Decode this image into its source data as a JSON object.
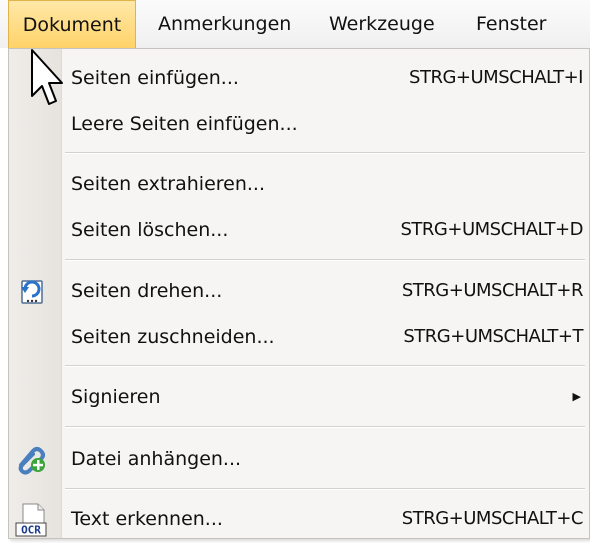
{
  "menubar": {
    "items": [
      {
        "label": "Dokument"
      },
      {
        "label": "Anmerkungen"
      },
      {
        "label": "Werkzeuge"
      },
      {
        "label": "Fenster"
      }
    ]
  },
  "dropdown": {
    "items": [
      {
        "label": "Seiten einfügen...",
        "shortcut": "STRG+UMSCHALT+I"
      },
      {
        "label": "Leere Seiten einfügen...",
        "shortcut": ""
      },
      {
        "label": "Seiten extrahieren...",
        "shortcut": ""
      },
      {
        "label": "Seiten löschen...",
        "shortcut": "STRG+UMSCHALT+D"
      },
      {
        "label": "Seiten drehen...",
        "shortcut": "STRG+UMSCHALT+R",
        "icon": "rotate-pages-icon"
      },
      {
        "label": "Seiten zuschneiden...",
        "shortcut": "STRG+UMSCHALT+T"
      },
      {
        "label": "Signieren",
        "shortcut": "",
        "submenu": true
      },
      {
        "label": "Datei anhängen...",
        "shortcut": "",
        "icon": "attach-file-icon"
      },
      {
        "label": "Text erkennen...",
        "shortcut": "STRG+UMSCHALT+C",
        "icon": "ocr-icon"
      }
    ]
  },
  "icons": {
    "ocr_icon_text": "OCR"
  },
  "colors": {
    "active_menu_bg": "#ffd267",
    "menu_bg": "#f6f5f3",
    "gutter_bg": "#e9e6e1"
  }
}
